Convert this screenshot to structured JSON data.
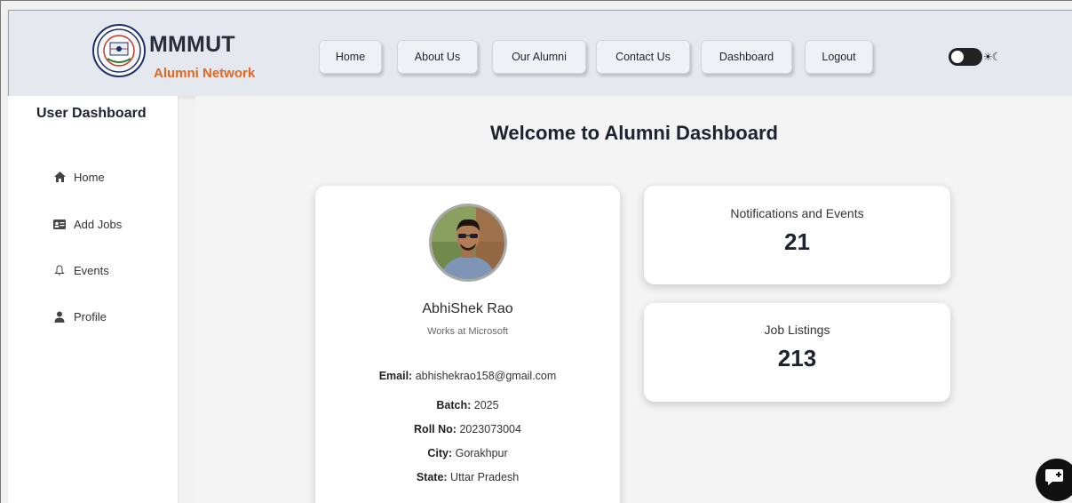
{
  "brand": {
    "title": "MMMUT",
    "subtitle": "Alumni Network"
  },
  "nav": {
    "items": [
      {
        "label": "Home"
      },
      {
        "label": "About Us"
      },
      {
        "label": "Our Alumni"
      },
      {
        "label": "Contact Us"
      },
      {
        "label": "Dashboard"
      },
      {
        "label": "Logout"
      }
    ],
    "theme_toggle_icons": "☀☾"
  },
  "sidebar": {
    "title": "User Dashboard",
    "items": [
      {
        "label": "Home",
        "icon": "house-icon"
      },
      {
        "label": "Add Jobs",
        "icon": "id-card-icon"
      },
      {
        "label": "Events",
        "icon": "bell-icon"
      },
      {
        "label": "Profile",
        "icon": "user-icon"
      }
    ]
  },
  "main": {
    "title": "Welcome to Alumni Dashboard"
  },
  "profile": {
    "name": "AbhiShek Rao",
    "work": "Works at Microsoft",
    "email_label": "Email:",
    "email": "abhishekrao158@gmail.com",
    "batch_label": "Batch:",
    "batch": "2025",
    "roll_label": "Roll No:",
    "roll": "2023073004",
    "city_label": "City:",
    "city": "Gorakhpur",
    "state_label": "State:",
    "state": "Uttar Pradesh"
  },
  "stats": {
    "notifications": {
      "label": "Notifications and Events",
      "value": "21"
    },
    "jobs": {
      "label": "Job Listings",
      "value": "213"
    }
  },
  "colors": {
    "header_bg": "#e5e9ef",
    "accent_orange": "#e2661c",
    "text_dark": "#1d2230"
  }
}
